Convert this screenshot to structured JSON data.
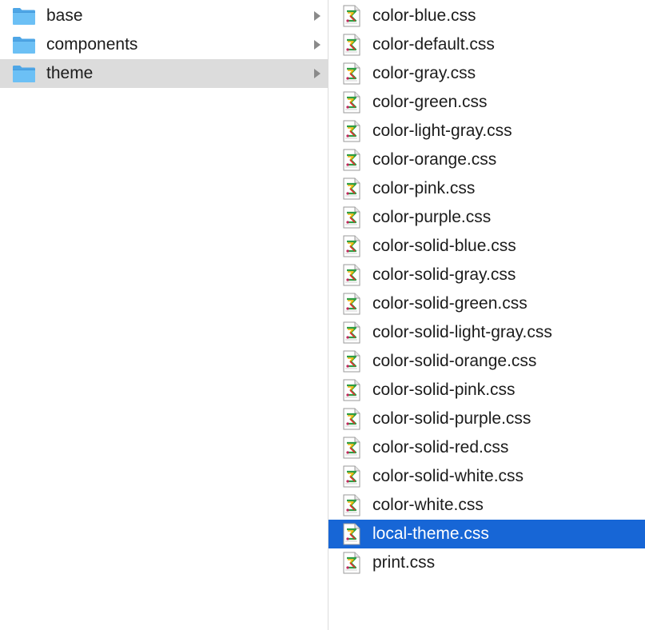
{
  "folders": [
    {
      "name": "base",
      "selected": false,
      "icon": "folder-icon"
    },
    {
      "name": "components",
      "selected": false,
      "icon": "folder-icon"
    },
    {
      "name": "theme",
      "selected": true,
      "icon": "folder-icon"
    }
  ],
  "files": [
    {
      "name": "color-blue.css",
      "selected": false
    },
    {
      "name": "color-default.css",
      "selected": false
    },
    {
      "name": "color-gray.css",
      "selected": false
    },
    {
      "name": "color-green.css",
      "selected": false
    },
    {
      "name": "color-light-gray.css",
      "selected": false
    },
    {
      "name": "color-orange.css",
      "selected": false
    },
    {
      "name": "color-pink.css",
      "selected": false
    },
    {
      "name": "color-purple.css",
      "selected": false
    },
    {
      "name": "color-solid-blue.css",
      "selected": false
    },
    {
      "name": "color-solid-gray.css",
      "selected": false
    },
    {
      "name": "color-solid-green.css",
      "selected": false
    },
    {
      "name": "color-solid-light-gray.css",
      "selected": false
    },
    {
      "name": "color-solid-orange.css",
      "selected": false
    },
    {
      "name": "color-solid-pink.css",
      "selected": false
    },
    {
      "name": "color-solid-purple.css",
      "selected": false
    },
    {
      "name": "color-solid-red.css",
      "selected": false
    },
    {
      "name": "color-solid-white.css",
      "selected": false
    },
    {
      "name": "color-white.css",
      "selected": false
    },
    {
      "name": "local-theme.css",
      "selected": true
    },
    {
      "name": "print.css",
      "selected": false
    }
  ],
  "colors": {
    "folder_selected_bg": "#dcdcdc",
    "file_selected_bg": "#1766d6",
    "folder_blue": "#5fb3ef"
  }
}
